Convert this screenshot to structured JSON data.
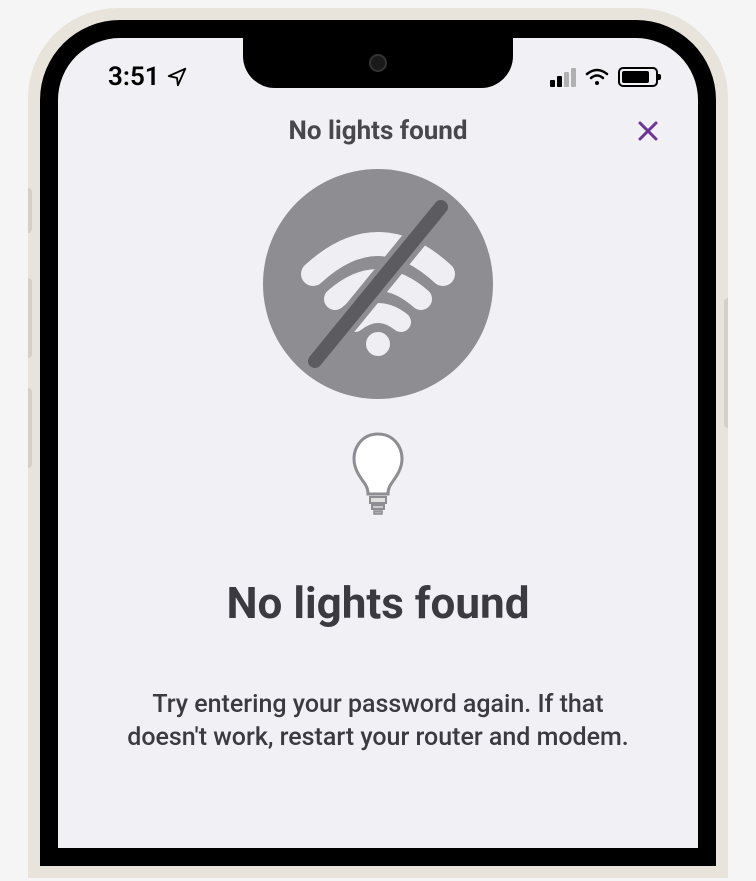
{
  "status_bar": {
    "time": "3:51",
    "cellular_bars_active": 2,
    "battery_percent": 85
  },
  "nav": {
    "title": "No lights found"
  },
  "content": {
    "heading": "No lights found",
    "description": "Try entering your password again. If that doesn't work, restart your router and modem."
  }
}
